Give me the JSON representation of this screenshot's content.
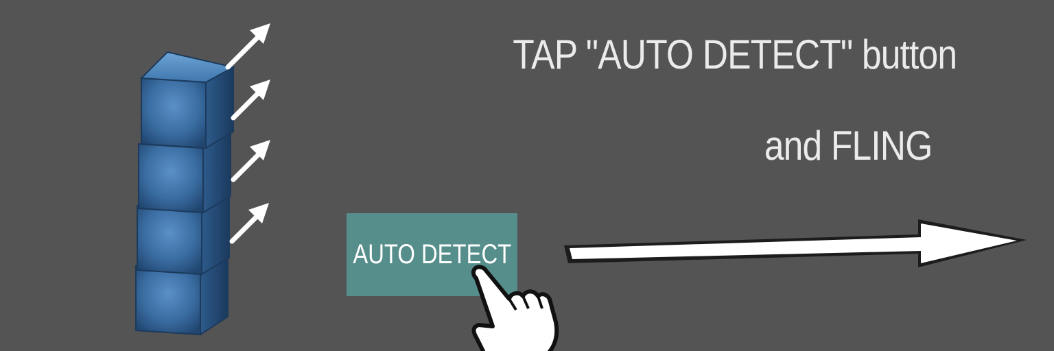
{
  "instruction": {
    "line1": "TAP \"AUTO DETECT\" button",
    "line2": "and FLING"
  },
  "button": {
    "label": "AUTO DETECT"
  },
  "colors": {
    "background": "#545454",
    "button": "#568e8b",
    "cube": "#3e6ea0",
    "text": "#ebebeb"
  },
  "icons": {
    "cube_stack": "stacked-blue-cubes-icon",
    "small_arrows": "up-right-arrow-icon",
    "hand": "pointing-hand-icon",
    "fling_arrow": "right-arrow-icon"
  }
}
